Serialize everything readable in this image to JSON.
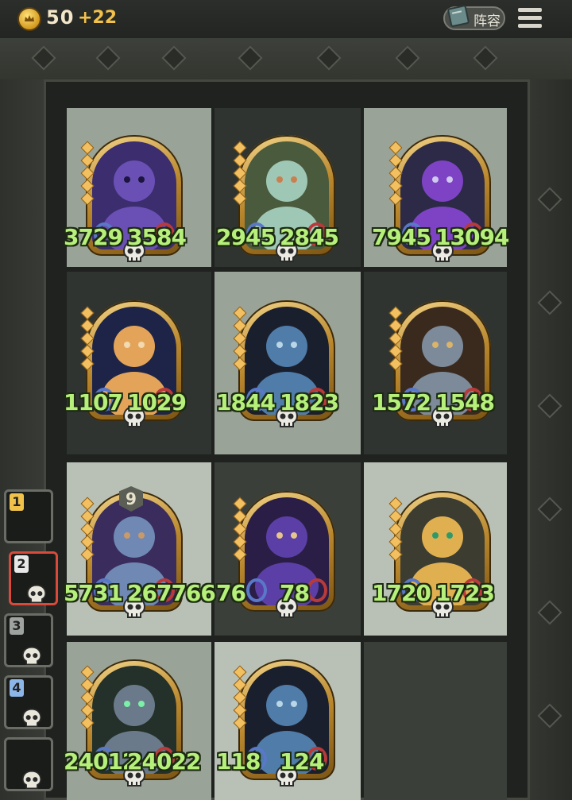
{
  "topbar": {
    "coins": "50",
    "coin_bonus": "+22",
    "lineup_label": "阵容",
    "icons": [
      "coin-icon",
      "book-icon",
      "menu-icon"
    ]
  },
  "heroes": [
    {
      "row": 0,
      "col": 0,
      "left": "3729",
      "right": "3584",
      "art": "purple-robot"
    },
    {
      "row": 0,
      "col": 1,
      "left": "2945",
      "right": "2845",
      "art": "mechanic-girl"
    },
    {
      "row": 0,
      "col": 2,
      "left": "7945",
      "right": "13094",
      "art": "purple-alien"
    },
    {
      "row": 1,
      "col": 0,
      "left": "1107",
      "right": "1029",
      "art": "praying-lady"
    },
    {
      "row": 1,
      "col": 1,
      "left": "1844",
      "right": "1823",
      "art": "dark-elf"
    },
    {
      "row": 1,
      "col": 2,
      "left": "1572",
      "right": "1548",
      "art": "painter-robot"
    },
    {
      "row": 2,
      "col": 0,
      "left": "5731",
      "right": "267766",
      "art": "musketeer",
      "level": "9"
    },
    {
      "row": 2,
      "col": 1,
      "left": "76",
      "right": "78",
      "art": "moon-witch"
    },
    {
      "row": 2,
      "col": 2,
      "left": "1720",
      "right": "1723",
      "art": "box-robot"
    },
    {
      "row": 3,
      "col": 0,
      "left": "24012",
      "right": "24022",
      "art": "dragon"
    },
    {
      "row": 3,
      "col": 1,
      "left": "118",
      "right": "124",
      "art": "dark-elf-2"
    }
  ],
  "queue": [
    {
      "num": "1",
      "color": "#f0c24a",
      "selected": false
    },
    {
      "num": "2",
      "color": "#e8e8e8",
      "selected": true
    },
    {
      "num": "3",
      "color": "#9fa3a0",
      "selected": false
    },
    {
      "num": "4",
      "color": "#8db6e8",
      "selected": false
    }
  ]
}
